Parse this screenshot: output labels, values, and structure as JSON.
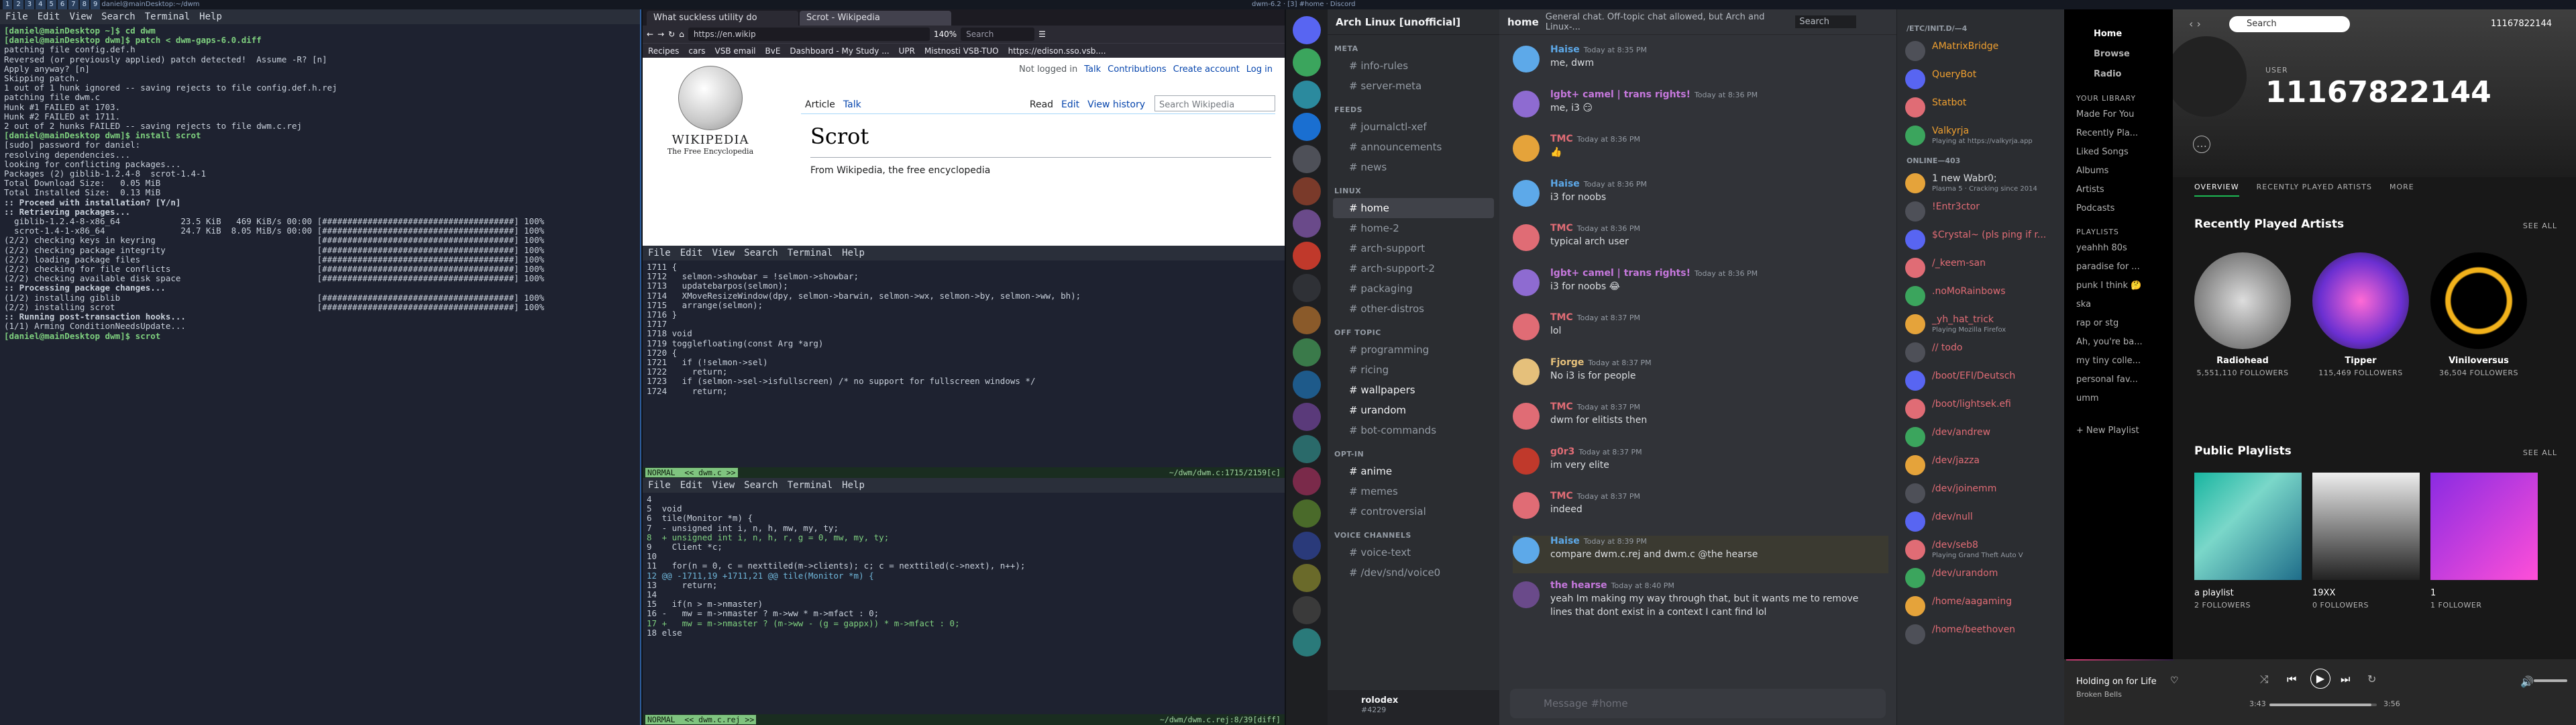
{
  "topbar": {
    "tags": [
      "1",
      "2",
      "3",
      "4",
      "5",
      "6",
      "7",
      "8",
      "9"
    ],
    "title": "daniel@mainDesktop:~/dwm",
    "window_title": "dwm-6.2 · [3] #home · Discord"
  },
  "term1": {
    "menu": [
      "File",
      "Edit",
      "View",
      "Search",
      "Terminal",
      "Help"
    ],
    "lines": [
      "[daniel@mainDesktop ~]$ cd dwm",
      "[daniel@mainDesktop dwm]$ patch < dwm-gaps-6.0.diff",
      "patching file config.def.h",
      "Reversed (or previously applied) patch detected!  Assume -R? [n]",
      "Apply anyway? [n]",
      "Skipping patch.",
      "1 out of 1 hunk ignored -- saving rejects to file config.def.h.rej",
      "patching file dwm.c",
      "Hunk #1 FAILED at 1703.",
      "Hunk #2 FAILED at 1711.",
      "2 out of 2 hunks FAILED -- saving rejects to file dwm.c.rej",
      "[daniel@mainDesktop dwm]$ install scrot",
      "[sudo] password for daniel:",
      "resolving dependencies...",
      "looking for conflicting packages...",
      "",
      "Packages (2) giblib-1.2.4-8  scrot-1.4-1",
      "",
      "Total Download Size:   0.05 MiB",
      "Total Installed Size:  0.13 MiB",
      "",
      ":: Proceed with installation? [Y/n]",
      ":: Retrieving packages...",
      "  giblib-1.2.4-8-x86_64            23.5 KiB   469 KiB/s 00:00 [######################################] 100%",
      "  scrot-1.4-1-x86_64               24.7 KiB  8.05 MiB/s 00:00 [######################################] 100%",
      "(2/2) checking keys in keyring                                [######################################] 100%",
      "(2/2) checking package integrity                              [######################################] 100%",
      "(2/2) loading package files                                   [######################################] 100%",
      "(2/2) checking for file conflicts                             [######################################] 100%",
      "(2/2) checking available disk space                           [######################################] 100%",
      ":: Processing package changes...",
      "(1/2) installing giblib                                       [######################################] 100%",
      "(2/2) installing scrot                                        [######################################] 100%",
      ":: Running post-transaction hooks...",
      "(1/1) Arming ConditionNeedsUpdate...",
      "[daniel@mainDesktop dwm]$ scrot"
    ]
  },
  "browser": {
    "tabs": [
      "What suckless utility do",
      "Scrot - Wikipedia"
    ],
    "url": "https://en.wikip",
    "zoom": "140%",
    "search": "Search",
    "bookmarks": [
      "Recipes",
      "cars",
      "VSB email",
      "BvE",
      "Dashboard - My Study ...",
      "UPR",
      "Mistnosti VSB-TUO",
      "https://edison.sso.vsb...."
    ],
    "wiki": {
      "logo_title": "WIKIPEDIA",
      "logo_sub": "The Free Encyclopedia",
      "not_logged": "Not logged in",
      "links": [
        "Talk",
        "Contributions",
        "Create account",
        "Log in"
      ],
      "tab_article": "Article",
      "tab_talk": "Talk",
      "tab_read": "Read",
      "tab_edit": "Edit",
      "tab_history": "View history",
      "search": "Search Wikipedia",
      "title": "Scrot",
      "from": "From Wikipedia, the free encyclopedia"
    }
  },
  "term2": {
    "menu": [
      "File",
      "Edit",
      "View",
      "Search",
      "Terminal",
      "Help"
    ],
    "lines": [
      "1711 {",
      "1712   selmon->showbar = !selmon->showbar;",
      "1713   updatebarpos(selmon);",
      "1714   XMoveResizeWindow(dpy, selmon->barwin, selmon->wx, selmon->by, selmon->ww, bh);",
      "1715   arrange(selmon);",
      "1716 }",
      "1717",
      "1718 void",
      "1719 togglefloating(const Arg *arg)",
      "1720 {",
      "1721   if (!selmon->sel)",
      "1722     return;",
      "1723   if (selmon->sel->isfullscreen) /* no support for fullscreen windows */",
      "1724     return;"
    ],
    "status_left": "NORMAL  << dwm.c >>",
    "status_right": "~/dwm/dwm.c:1715/2159[c]"
  },
  "term3": {
    "menu": [
      "File",
      "Edit",
      "View",
      "Search",
      "Terminal",
      "Help"
    ],
    "lines": [
      "4",
      "5  void",
      "6  tile(Monitor *m) {",
      "7  - unsigned int i, n, h, mw, my, ty;",
      "8  + unsigned int i, n, h, r, g = 0, mw, my, ty;",
      "9    Client *c;",
      "10",
      "11   for(n = 0, c = nexttiled(m->clients); c; c = nexttiled(c->next), n++);",
      "12 @@ -1711,19 +1711,21 @@ tile(Monitor *m) {",
      "13     return;",
      "14",
      "15   if(n > m->nmaster)",
      "16 -   mw = m->nmaster ? m->ww * m->mfact : 0;",
      "17 +   mw = m->nmaster ? (m->ww - (g = gappx)) * m->mfact : 0;",
      "18 else"
    ],
    "status_left": "NORMAL  << dwm.c.rej >>",
    "status_right": "~/dwm/dwm.c.rej:8/39[diff]"
  },
  "discord": {
    "server": "Arch Linux [unofficial]",
    "channel": "home",
    "topic": "General chat. Off-topic chat allowed, but Arch and Linux-...",
    "search": "Search",
    "categories": [
      {
        "name": "META",
        "channels": [
          "info-rules",
          "server-meta"
        ]
      },
      {
        "name": "FEEDS",
        "channels": [
          "journalctl-xef",
          "announcements",
          "news"
        ]
      },
      {
        "name": "LINUX",
        "channels": [
          "home",
          "home-2",
          "arch-support",
          "arch-support-2",
          "packaging",
          "other-distros"
        ]
      },
      {
        "name": "OFF TOPIC",
        "channels": [
          "programming",
          "ricing",
          "wallpapers",
          "urandom",
          "bot-commands"
        ]
      },
      {
        "name": "OPT-IN",
        "channels": [
          "anime",
          "memes",
          "controversial"
        ]
      },
      {
        "name": "VOICE CHANNELS",
        "channels": [
          "voice-text",
          "/dev/snd/voice0"
        ]
      }
    ],
    "user": {
      "name": "rolodex",
      "tag": "#4229"
    },
    "messages": [
      {
        "name": "Haise",
        "time": "Today at 8:35 PM",
        "text": "me, dwm",
        "color": "#5da9e9"
      },
      {
        "name": "lgbt+ camel | trans rights!",
        "time": "Today at 8:36 PM",
        "text": "me, i3 😏",
        "color": "#c678dd"
      },
      {
        "name": "TMC",
        "time": "Today at 8:36 PM",
        "text": "👍",
        "color": "#e06c75"
      },
      {
        "name": "Haise",
        "time": "Today at 8:36 PM",
        "text": "i3 for noobs",
        "color": "#5da9e9"
      },
      {
        "name": "TMC",
        "time": "Today at 8:36 PM",
        "text": "typical arch user",
        "color": "#e06c75"
      },
      {
        "name": "lgbt+ camel | trans rights!",
        "time": "Today at 8:36 PM",
        "text": "i3 for noobs 😂",
        "color": "#c678dd"
      },
      {
        "name": "TMC",
        "time": "Today at 8:37 PM",
        "text": "lol",
        "color": "#e06c75"
      },
      {
        "name": "Fjorge",
        "time": "Today at 8:37 PM",
        "text": "No i3 is for people",
        "color": "#e5c07b"
      },
      {
        "name": "TMC",
        "time": "Today at 8:37 PM",
        "text": "dwm for elitists then",
        "color": "#e06c75"
      },
      {
        "name": "g0r3",
        "time": "Today at 8:37 PM",
        "text": "im very elite",
        "color": "#e06c75"
      },
      {
        "name": "TMC",
        "time": "Today at 8:37 PM",
        "text": "indeed",
        "color": "#e06c75"
      },
      {
        "name": "Haise",
        "time": "Today at 8:39 PM",
        "text": "compare dwm.c.rej and dwm.c @the hearse",
        "color": "#5da9e9"
      },
      {
        "name": "the hearse",
        "time": "Today at 8:40 PM",
        "text": "yeah Im making my way through that, but it wants me to remove",
        "text2": "lines that dont exist in a context I cant find lol",
        "color": "#c678dd"
      }
    ],
    "input": "Message #home",
    "members_head1": "/ETC/INIT.D/—4",
    "members_head2": "ONLINE—403",
    "members": [
      {
        "n": "AMatrixBridge",
        "s": "",
        "c": "#f0a030"
      },
      {
        "n": "QueryBot",
        "s": "",
        "c": "#f0a030"
      },
      {
        "n": "Statbot",
        "s": "",
        "c": "#f0a030"
      },
      {
        "n": "Valkyrja",
        "s": "Playing at https://valkyrja.app",
        "c": "#f0a030"
      },
      {
        "n": "1 new Wabr0;",
        "s": "Plasma 5 · Cracking since 2014",
        "c": "#dbdee1"
      },
      {
        "n": "!Entr3ctor",
        "s": "",
        "c": "#e06c75"
      },
      {
        "n": "$Crystal~ (pls ping if r...",
        "s": "",
        "c": "#e06c75"
      },
      {
        "n": "/_keem-san",
        "s": "",
        "c": "#e06c75"
      },
      {
        "n": ".noMoRainbows",
        "s": "",
        "c": "#e06c75"
      },
      {
        "n": "_yh_hat_trick",
        "s": "Playing Mozilla Firefox",
        "c": "#e06c75"
      },
      {
        "n": "// todo",
        "s": "",
        "c": "#e06c75"
      },
      {
        "n": "/boot/EFI/Deutsch",
        "s": "",
        "c": "#e06c75"
      },
      {
        "n": "/boot/lightsek.efi",
        "s": "",
        "c": "#e06c75"
      },
      {
        "n": "/dev/andrew",
        "s": "",
        "c": "#e06c75"
      },
      {
        "n": "/dev/jazza",
        "s": "",
        "c": "#e06c75"
      },
      {
        "n": "/dev/joinemm",
        "s": "",
        "c": "#e06c75"
      },
      {
        "n": "/dev/null",
        "s": "",
        "c": "#e06c75"
      },
      {
        "n": "/dev/seb8",
        "s": "Playing Grand Theft Auto V",
        "c": "#e06c75"
      },
      {
        "n": "/dev/urandom",
        "s": "",
        "c": "#e06c75"
      },
      {
        "n": "/home/aagaming",
        "s": "",
        "c": "#e06c75"
      },
      {
        "n": "/home/beethoven",
        "s": "",
        "c": "#e06c75"
      }
    ]
  },
  "spotify": {
    "nav": [
      "Home",
      "Browse",
      "Radio"
    ],
    "lib_head": "YOUR LIBRARY",
    "lib": [
      "Made For You",
      "Recently Pla...",
      "Liked Songs",
      "Albums",
      "Artists",
      "Podcasts"
    ],
    "pl_head": "PLAYLISTS",
    "playlists": [
      "yeahhh 80s",
      "paradise for ...",
      "punk I think 🤔",
      "ska",
      "rap or stg",
      "Ah, you're ba...",
      "my tiny colle...",
      "personal fav...",
      "umm"
    ],
    "new_playlist": "New Playlist",
    "search": "Search",
    "account": "11167822144",
    "user_label": "USER",
    "user_name": "11167822144",
    "tabs": [
      "OVERVIEW",
      "RECENTLY PLAYED ARTISTS",
      "MORE"
    ],
    "rp_head": "Recently Played Artists",
    "see_all": "SEE ALL",
    "artists": [
      {
        "n": "Radiohead",
        "f": "5,551,110 FOLLOWERS"
      },
      {
        "n": "Tipper",
        "f": "115,469 FOLLOWERS"
      },
      {
        "n": "Viniloversus",
        "f": "36,504 FOLLOWERS"
      }
    ],
    "pp_head": "Public Playlists",
    "public": [
      {
        "n": "a playlist",
        "f": "2 FOLLOWERS"
      },
      {
        "n": "19XX",
        "f": "0 FOLLOWERS"
      },
      {
        "n": "1",
        "f": "1 FOLLOWER"
      }
    ],
    "track": "Holding on for Life",
    "artist": "Broken Bells",
    "elapsed": "3:43",
    "duration": "3:56",
    "progress": 0.95
  }
}
